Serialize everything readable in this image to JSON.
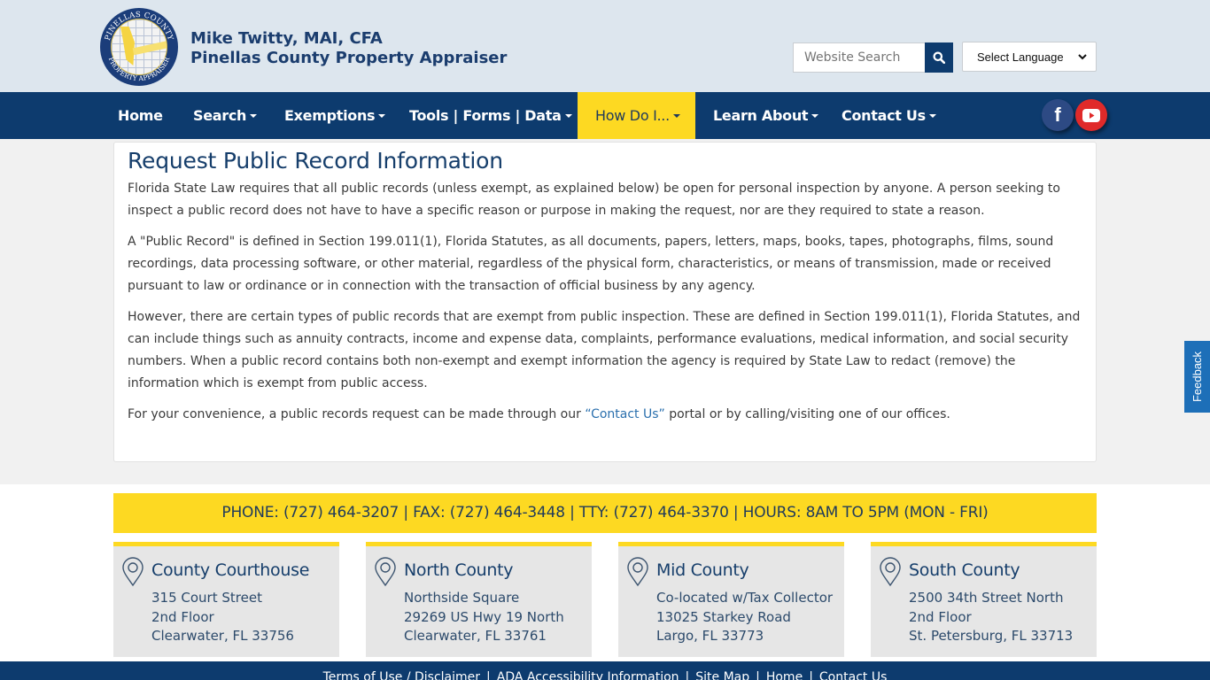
{
  "header": {
    "name_line": "Mike Twitty, MAI, CFA",
    "office_line": "Pinellas County Property Appraiser",
    "logo_alt": "Pinellas County Property Appraiser seal",
    "search_placeholder": "Website Search",
    "search_icon": "search-icon",
    "language_select": "Select Language"
  },
  "nav": {
    "items": [
      {
        "label": "Home",
        "dropdown": false
      },
      {
        "label": "Search",
        "dropdown": true
      },
      {
        "label": "Exemptions",
        "dropdown": true
      },
      {
        "label": "Tools | Forms | Data",
        "dropdown": true
      },
      {
        "label": "How Do I...",
        "dropdown": true,
        "active": true
      },
      {
        "label": "Learn About",
        "dropdown": true
      },
      {
        "label": "Contact Us",
        "dropdown": true
      }
    ],
    "social": [
      {
        "name": "facebook",
        "glyph": "f",
        "color": "#2d4a84"
      },
      {
        "name": "youtube",
        "color": "#e02a2a"
      }
    ]
  },
  "main": {
    "title": "Request Public Record Information",
    "paragraphs": [
      "Florida State Law requires that all public records (unless exempt, as explained below) be open for personal inspection by anyone. A person seeking to inspect a public record does not have to have a specific reason or purpose in making the request, nor are they required to state a reason.",
      "A \"Public Record\" is defined in Section 199.011(1), Florida Statutes, as all documents, papers, letters, maps, books, tapes, photographs, films, sound recordings, data processing software, or other material, regardless of the physical form, characteristics, or means of transmission, made or received pursuant to law or ordinance or in connection with the transaction of official business by any agency.",
      "However, there are certain types of public records that are exempt from public inspection. These are defined in Section 199.011(1), Florida Statutes, and can include things such as annuity contracts, income and expense data, complaints, performance evaluations, medical information, and social security numbers. When a public record contains both non-exempt and exempt information the agency is required by State Law to redact (remove) the information which is exempt from public access."
    ],
    "last_paragraph": {
      "before": "For your convenience, a public records request can be made through our ",
      "link": "“Contact Us”",
      "after": " portal or by calling/visiting one of our offices."
    }
  },
  "feedback_label": "Feedback",
  "contact_bar": "PHONE: (727) 464-3207 | FAX: (727) 464-3448 | TTY: (727) 464-3370 | HOURS: 8AM TO 5PM (MON - FRI)",
  "offices": [
    {
      "name": "County Courthouse",
      "lines": [
        "315 Court Street",
        "2nd Floor",
        "Clearwater, FL 33756"
      ]
    },
    {
      "name": "North County",
      "lines": [
        "Northside Square",
        "29269 US Hwy 19 North",
        "Clearwater, FL 33761"
      ]
    },
    {
      "name": "Mid County",
      "lines": [
        "Co-located w/Tax Collector",
        "13025 Starkey Road",
        "Largo, FL 33773"
      ]
    },
    {
      "name": "South County",
      "lines": [
        "2500 34th Street North",
        "2nd Floor",
        "St. Petersburg, FL 33713"
      ]
    }
  ],
  "footer_links": [
    "Terms of Use / Disclaimer",
    "ADA Accessibility Information",
    "Site Map",
    "Home",
    "Contact Us"
  ],
  "colors": {
    "navy": "#0d3b6e",
    "accent_yellow": "#fdd922",
    "header_bg": "#dde6ee",
    "link_blue": "#2a6fad",
    "feedback_blue": "#1d6fb8"
  }
}
